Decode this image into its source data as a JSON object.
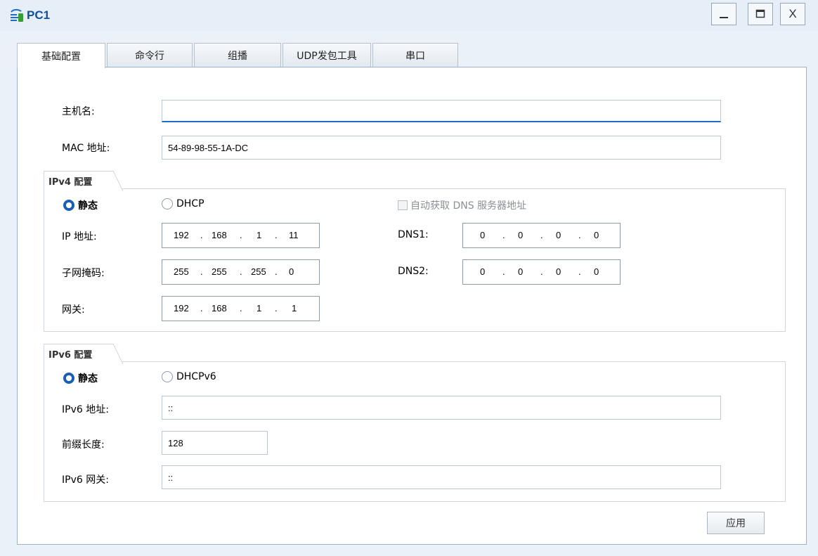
{
  "window": {
    "title": "PC1",
    "min_symbol": "_",
    "close_symbol": "X",
    "icon": "network-pc-icon"
  },
  "tabs": [
    "基础配置",
    "命令行",
    "组播",
    "UDP发包工具",
    "串口"
  ],
  "basic": {
    "hostname_label": "主机名:",
    "hostname_value": "",
    "mac_label": "MAC 地址:",
    "mac_value": "54-89-98-55-1A-DC"
  },
  "ipv4": {
    "group_title": "IPv4 配置",
    "static_label": "静态",
    "dhcp_label": "DHCP",
    "mode": "static",
    "auto_dns_label": "自动获取 DNS 服务器地址",
    "auto_dns_checked": false,
    "ip_label": "IP 地址:",
    "ip": [
      "192",
      "168",
      "1",
      "11"
    ],
    "mask_label": "子网掩码:",
    "mask": [
      "255",
      "255",
      "255",
      "0"
    ],
    "gateway_label": "网关:",
    "gateway": [
      "192",
      "168",
      "1",
      "1"
    ],
    "dns1_label": "DNS1:",
    "dns1": [
      "0",
      "0",
      "0",
      "0"
    ],
    "dns2_label": "DNS2:",
    "dns2": [
      "0",
      "0",
      "0",
      "0"
    ]
  },
  "ipv6": {
    "group_title": "IPv6 配置",
    "static_label": "静态",
    "dhcp_label": "DHCPv6",
    "mode": "static",
    "addr_label": "IPv6 地址:",
    "addr_value": "::",
    "prefix_label": "前缀长度:",
    "prefix_value": "128",
    "gw_label": "IPv6 网关:",
    "gw_value": "::"
  },
  "apply_label": "应用",
  "colors": {
    "accent": "#1a5fb6",
    "title_text": "#134e9c",
    "window_bg": "#eaf1f8"
  }
}
